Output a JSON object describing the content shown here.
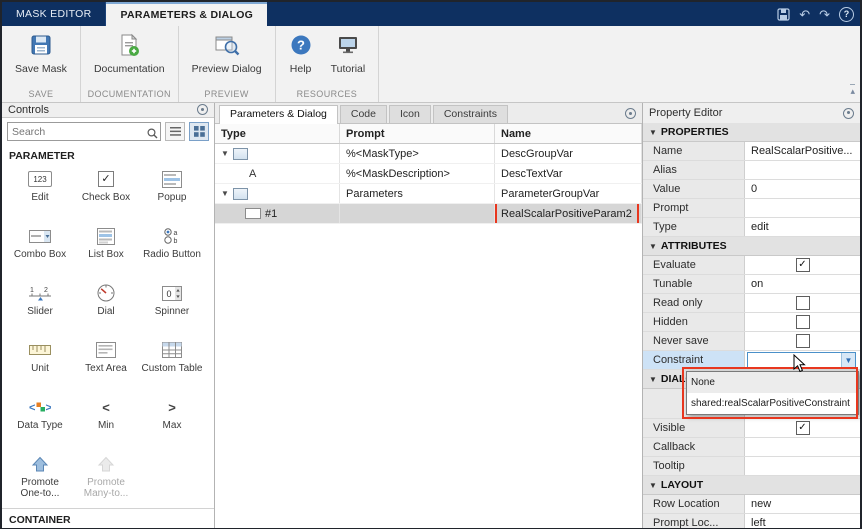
{
  "titlebar": {
    "tabs": [
      {
        "label": "MASK EDITOR"
      },
      {
        "label": "PARAMETERS & DIALOG"
      }
    ]
  },
  "toolbar": {
    "groups": [
      {
        "label": "SAVE",
        "buttons": [
          {
            "label": "Save Mask",
            "icon": "save-mask-icon"
          }
        ]
      },
      {
        "label": "DOCUMENTATION",
        "buttons": [
          {
            "label": "Documentation",
            "icon": "documentation-icon"
          }
        ]
      },
      {
        "label": "PREVIEW",
        "buttons": [
          {
            "label": "Preview Dialog",
            "icon": "preview-dialog-icon"
          }
        ]
      },
      {
        "label": "RESOURCES",
        "buttons": [
          {
            "label": "Help",
            "icon": "help-icon"
          },
          {
            "label": "Tutorial",
            "icon": "tutorial-icon"
          }
        ]
      }
    ]
  },
  "controls": {
    "title": "Controls",
    "search_placeholder": "Search",
    "parameter_section": "PARAMETER",
    "container_section": "CONTAINER",
    "items": [
      {
        "label": "Edit"
      },
      {
        "label": "Check Box"
      },
      {
        "label": "Popup"
      },
      {
        "label": "Combo Box"
      },
      {
        "label": "List Box"
      },
      {
        "label": "Radio Button"
      },
      {
        "label": "Slider"
      },
      {
        "label": "Dial"
      },
      {
        "label": "Spinner"
      },
      {
        "label": "Unit"
      },
      {
        "label": "Text Area"
      },
      {
        "label": "Custom Table"
      },
      {
        "label": "Data Type"
      },
      {
        "label": "Min"
      },
      {
        "label": "Max"
      },
      {
        "label": "Promote One-to..."
      },
      {
        "label": "Promote Many-to..."
      }
    ]
  },
  "editor": {
    "tabs": [
      {
        "label": "Parameters & Dialog"
      },
      {
        "label": "Code"
      },
      {
        "label": "Icon"
      },
      {
        "label": "Constraints"
      }
    ],
    "columns": {
      "type": "Type",
      "prompt": "Prompt",
      "name": "Name"
    },
    "rows": [
      {
        "prompt": "%<MaskType>",
        "name": "DescGroupVar"
      },
      {
        "type_label": "A",
        "prompt": "%<MaskDescription>",
        "name": "DescTextVar"
      },
      {
        "prompt": "Parameters",
        "name": "ParameterGroupVar"
      },
      {
        "type_label": "#1",
        "prompt": "",
        "name": "RealScalarPositiveParam2"
      }
    ]
  },
  "property_editor": {
    "title": "Property Editor",
    "rows": [
      {
        "section": "PROPERTIES"
      },
      {
        "label": "Name",
        "value": "RealScalarPositive..."
      },
      {
        "label": "Alias",
        "value": ""
      },
      {
        "label": "Value",
        "value": "0"
      },
      {
        "label": "Prompt",
        "value": ""
      },
      {
        "label": "Type",
        "value": "edit"
      },
      {
        "section": "ATTRIBUTES"
      },
      {
        "label": "Evaluate",
        "check": "✓"
      },
      {
        "label": "Tunable",
        "value": "on"
      },
      {
        "label": "Read only",
        "check": ""
      },
      {
        "label": "Hidden",
        "check": ""
      },
      {
        "label": "Never save",
        "check": ""
      },
      {
        "label": "Constraint",
        "value": ""
      },
      {
        "section": "DIALOG"
      },
      {
        "label": "Visible",
        "check": "✓"
      },
      {
        "label": "Callback",
        "value": ""
      },
      {
        "label": "Tooltip",
        "value": ""
      },
      {
        "section": "LAYOUT"
      },
      {
        "label": "Row Location",
        "value": "new"
      },
      {
        "label": "Prompt Loc...",
        "value": "left"
      }
    ],
    "dropdown_options": [
      {
        "label": "None"
      },
      {
        "label": "shared:realScalarPositiveConstraint"
      }
    ]
  }
}
